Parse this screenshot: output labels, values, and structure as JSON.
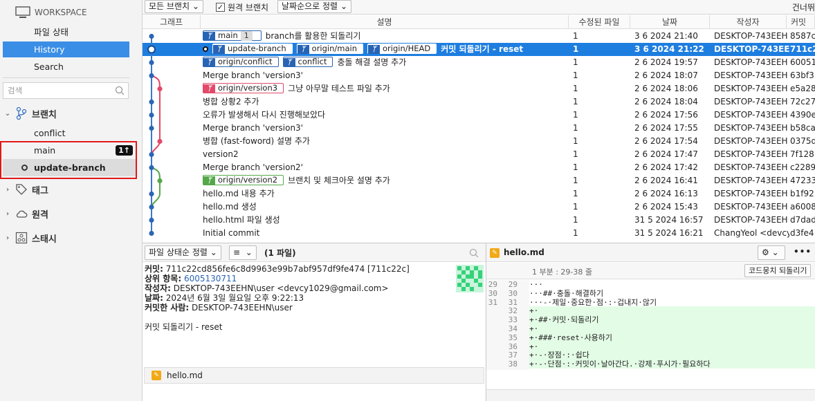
{
  "sidebar": {
    "workspace_label": "WORKSPACE",
    "nav": [
      "파일 상태",
      "History",
      "Search"
    ],
    "search_placeholder": "검색",
    "branches_label": "브랜치",
    "branches": [
      {
        "name": "conflict",
        "current": false
      },
      {
        "name": "main",
        "current": false,
        "ahead": "1↑"
      },
      {
        "name": "update-branch",
        "current": true
      }
    ],
    "tags_label": "태그",
    "remotes_label": "원격",
    "stashes_label": "스태시"
  },
  "toolbar": {
    "all_branches": "모든 브랜치",
    "remote_branches": "원격 브랜치",
    "sort": "날짜순으로 정렬",
    "skip": "건너뛰"
  },
  "columns": [
    "그래프",
    "설명",
    "수정된 파일",
    "날짜",
    "작성자",
    "커밋"
  ],
  "commits": [
    {
      "tags": [
        {
          "name": "main",
          "color": "blue",
          "count": "1"
        }
      ],
      "desc": "branch를 활용한 되돌리기",
      "files": "1",
      "date": "3 6 2024 21:40",
      "author": "DESKTOP-743EEH",
      "hash": "8587c"
    },
    {
      "head": true,
      "tags": [
        {
          "name": "update-branch",
          "color": "blue"
        },
        {
          "name": "origin/main",
          "color": "blue"
        },
        {
          "name": "origin/HEAD",
          "color": "blue"
        }
      ],
      "desc": "커밋 되돌리기 - reset",
      "files": "1",
      "date": "3 6 2024 21:22",
      "author": "DESKTOP-743EEH",
      "hash": "711c2",
      "selected": true
    },
    {
      "tags": [
        {
          "name": "origin/conflict",
          "color": "blue"
        },
        {
          "name": "conflict",
          "color": "blue"
        }
      ],
      "desc": "충돌 해결 설명 추가",
      "files": "1",
      "date": "2 6 2024 19:57",
      "author": "DESKTOP-743EEH",
      "hash": "60051"
    },
    {
      "tags": [],
      "desc": "Merge branch 'version3'",
      "files": "1",
      "date": "2 6 2024 18:07",
      "author": "DESKTOP-743EEH",
      "hash": "63bf3"
    },
    {
      "tags": [
        {
          "name": "origin/version3",
          "color": "red"
        }
      ],
      "desc": "그냥 아무말 테스트 파일 추가",
      "files": "1",
      "date": "2 6 2024 18:06",
      "author": "DESKTOP-743EEH",
      "hash": "e5a28"
    },
    {
      "tags": [],
      "desc": "병합 상황2 추가",
      "files": "1",
      "date": "2 6 2024 18:04",
      "author": "DESKTOP-743EEH",
      "hash": "72c27"
    },
    {
      "tags": [],
      "desc": "오류가 발생해서 다시 진행해보았다",
      "files": "1",
      "date": "2 6 2024 17:56",
      "author": "DESKTOP-743EEH",
      "hash": "4390e"
    },
    {
      "tags": [],
      "desc": "Merge branch 'version3'",
      "files": "1",
      "date": "2 6 2024 17:55",
      "author": "DESKTOP-743EEH",
      "hash": "b58ca"
    },
    {
      "tags": [],
      "desc": " 병합 (fast-foword) 설명 추가",
      "files": "1",
      "date": "2 6 2024 17:54",
      "author": "DESKTOP-743EEH",
      "hash": "0375d"
    },
    {
      "tags": [],
      "desc": "version2",
      "files": "1",
      "date": "2 6 2024 17:47",
      "author": "DESKTOP-743EEH",
      "hash": "7f128"
    },
    {
      "tags": [],
      "desc": "Merge branch 'version2'",
      "files": "1",
      "date": "2 6 2024 17:42",
      "author": "DESKTOP-743EEH",
      "hash": "c2289"
    },
    {
      "tags": [
        {
          "name": "origin/version2",
          "color": "green"
        }
      ],
      "desc": "브랜치 및 체크아웃 설명 추가",
      "files": "1",
      "date": "2 6 2024 16:41",
      "author": "DESKTOP-743EEH",
      "hash": "47233"
    },
    {
      "tags": [],
      "desc": "hello.md 내용 추가",
      "files": "1",
      "date": "2 6 2024 16:13",
      "author": "DESKTOP-743EEH",
      "hash": "b1f92"
    },
    {
      "tags": [],
      "desc": "hello.md 생성",
      "files": "1",
      "date": "2 6 2024 15:43",
      "author": "DESKTOP-743EEH",
      "hash": "a6008"
    },
    {
      "tags": [],
      "desc": "hello.html 파일 생성",
      "files": "1",
      "date": "31 5 2024 16:57",
      "author": "DESKTOP-743EEH",
      "hash": "d7dad"
    },
    {
      "tags": [],
      "desc": "Initial commit",
      "files": "1",
      "date": "31 5 2024 16:21",
      "author": "ChangYeol <devcy",
      "hash": "d3fe4"
    }
  ],
  "bottom_left": {
    "sort_label": "파일 상태순 정렬",
    "list_icon": "≡",
    "file_count": "(1 파일)",
    "commit_label": "커밋:",
    "commit_value": "711c22cd856fe6c8d9963e99b7abf957df9fe474 [711c22c]",
    "parent_label": "상위 항목:",
    "parent_value": "6005130711",
    "author_label": "작성자:",
    "author_value": "DESKTOP-743EEHN\\user <devcy1029@gmail.com>",
    "date_label": "날짜:",
    "date_value": "2024년 6월 3일 월요일 오후 9:22:13",
    "committer_label": "커밋한 사람:",
    "committer_value": "DESKTOP-743EEHN\\user",
    "message": "커밋 되돌리기 - reset",
    "file": "hello.md"
  },
  "bottom_right": {
    "file": "hello.md",
    "hunk": "1 부분 : 29-38 줄",
    "revert_button": "코드뭉치 되돌리기",
    "more": "•••",
    "lines": [
      {
        "n1": "29",
        "n2": "29",
        "text": "···",
        "added": false
      },
      {
        "n1": "30",
        "n2": "30",
        "text": "···##·충돌·해결하기",
        "added": false
      },
      {
        "n1": "31",
        "n2": "31",
        "text": "···-·제일·중요한·점·:·겁내지·않기",
        "added": false
      },
      {
        "n1": "",
        "n2": "32",
        "text": "+·",
        "added": true
      },
      {
        "n1": "",
        "n2": "33",
        "text": "+·##·커밋·되돌리기",
        "added": true
      },
      {
        "n1": "",
        "n2": "34",
        "text": "+·",
        "added": true
      },
      {
        "n1": "",
        "n2": "35",
        "text": "+·###·reset·사용하기",
        "added": true
      },
      {
        "n1": "",
        "n2": "36",
        "text": "+·",
        "added": true
      },
      {
        "n1": "",
        "n2": "37",
        "text": "+·-·장점·:·쉽다",
        "added": true
      },
      {
        "n1": "",
        "n2": "38",
        "text": "+·-·단점·:·커밋이·날아간다.·강제·푸시가·필요하다",
        "added": true
      }
    ]
  },
  "colors": {
    "accent": "#1e7ee0",
    "tag_blue": "#2864b4",
    "tag_red": "#e24a6a",
    "tag_green": "#55a84a",
    "added_bg": "#e3fce6"
  }
}
